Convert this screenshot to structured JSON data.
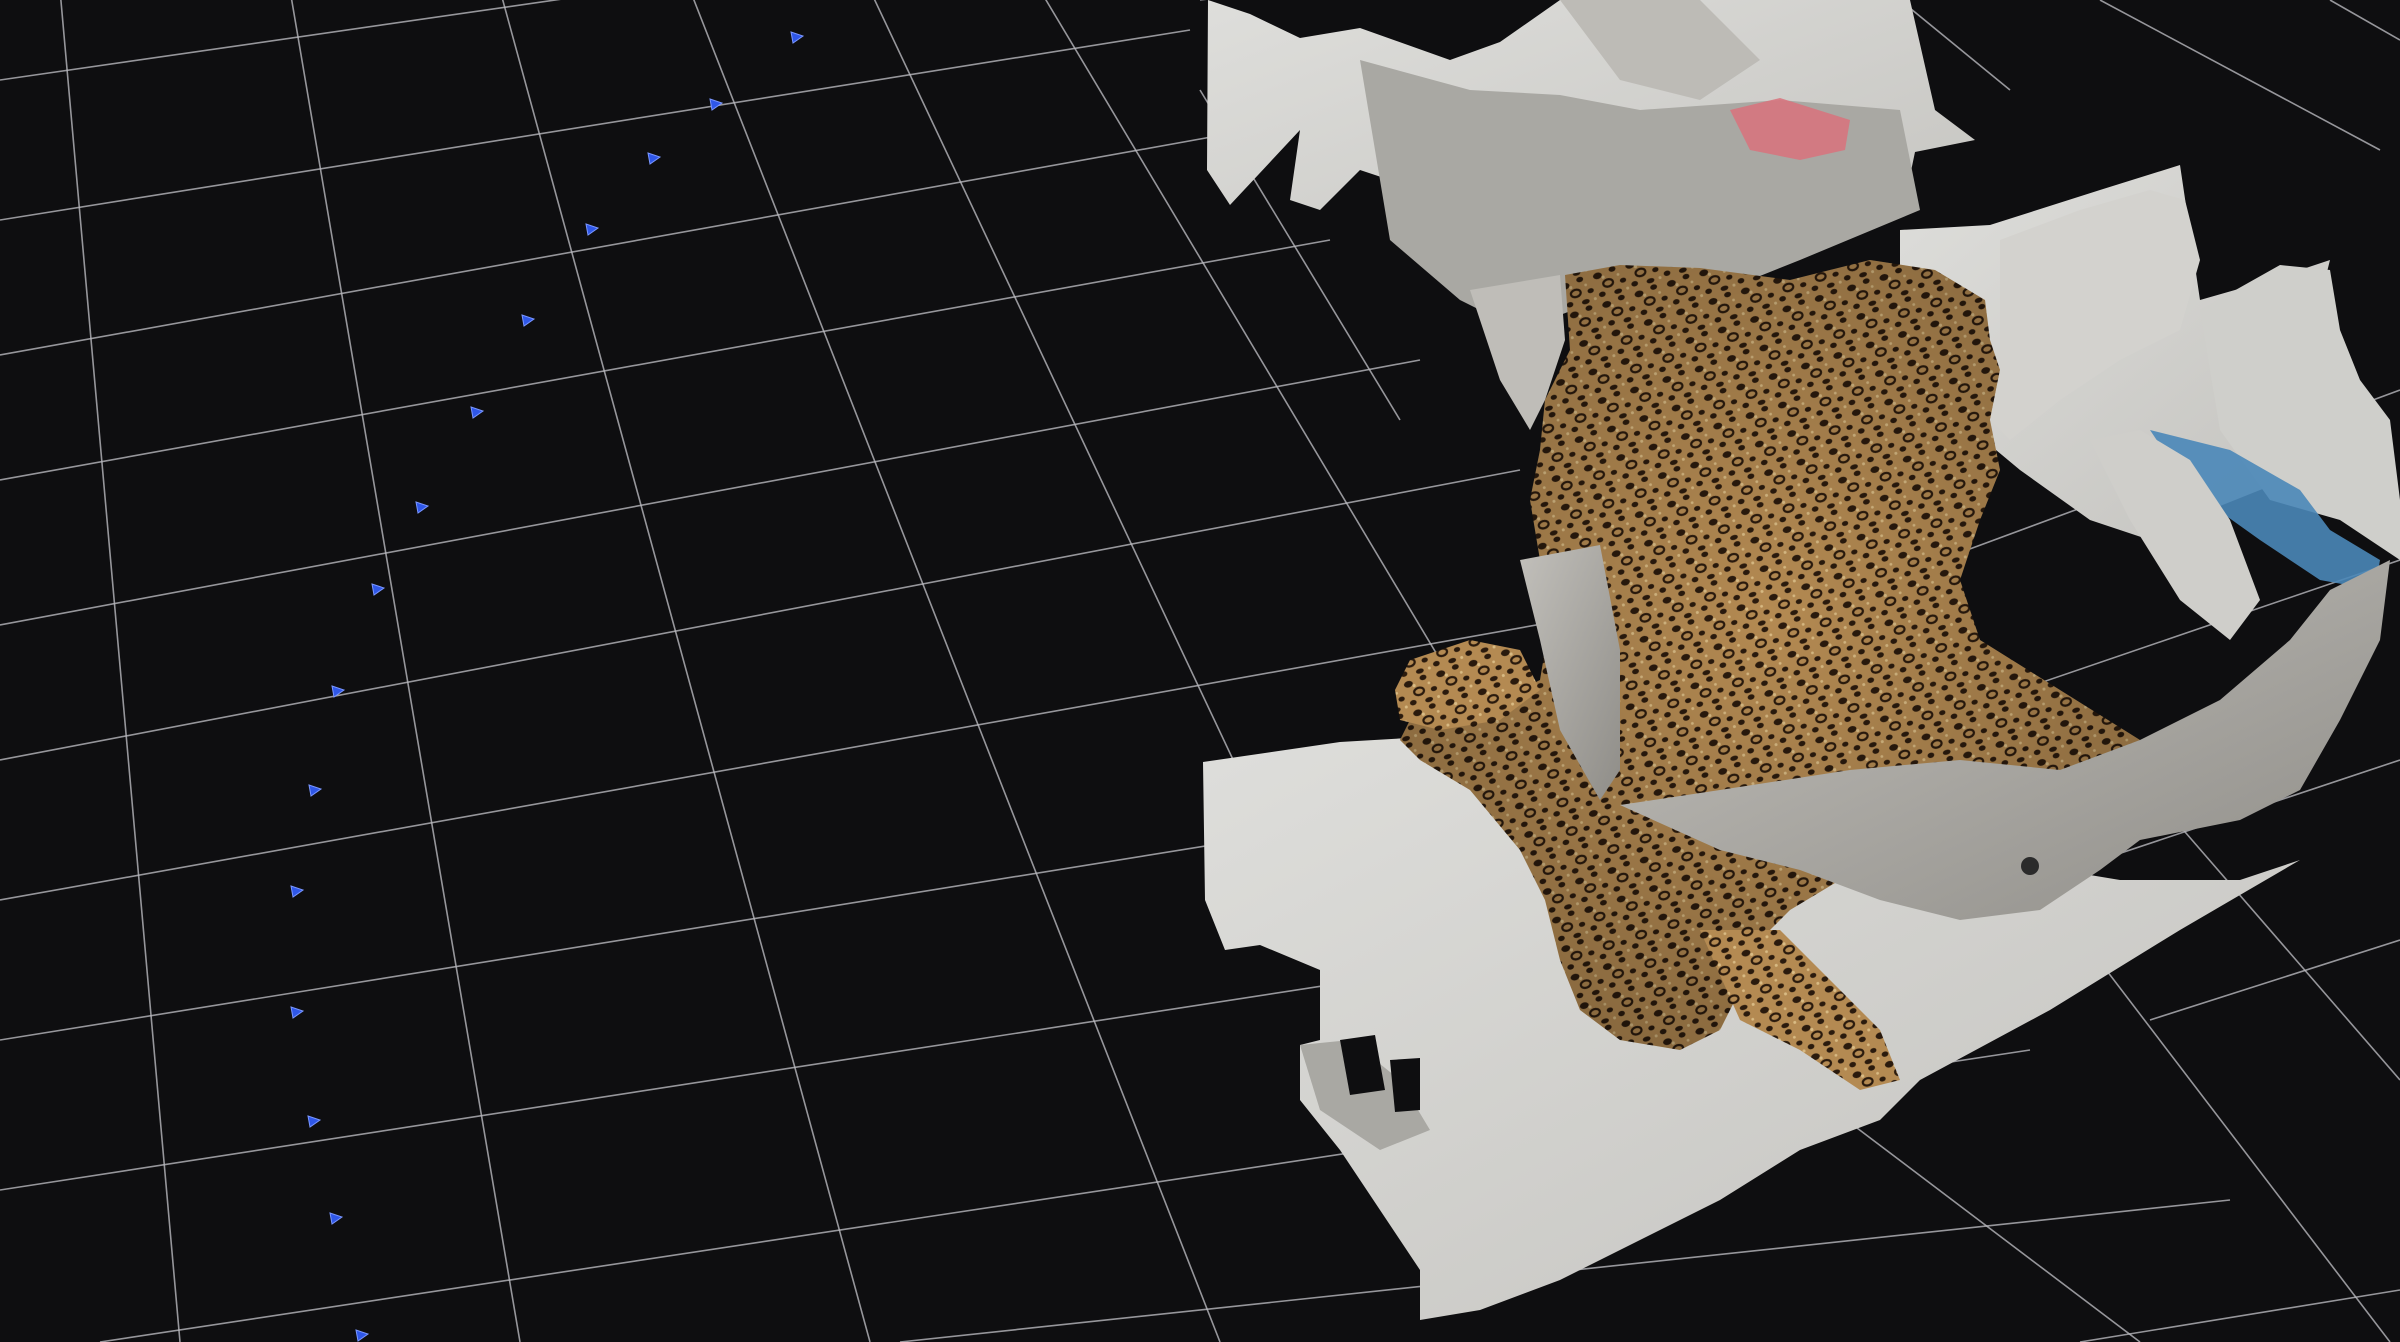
{
  "viewer": {
    "background_color": "#0e0e10",
    "grid_visible": true,
    "grid_color": "#b9b9be",
    "camera_marker_color": "#2f57e8",
    "camera_marker_icon": "camera-frustum-icon",
    "camera_count": 15
  },
  "model": {
    "subject": "leopard-skin-photogrammetry-mesh",
    "colors": {
      "paper": "#d6d6d3",
      "paper_shadow": "#a9a8a3",
      "gray_panel": "#b3b1ac",
      "fur_base": "#b48a52",
      "fur_light": "#d9bb84",
      "spot": "#2a1a0d",
      "pink_object": "#d9727d",
      "blue_object": "#4a87b8"
    }
  }
}
